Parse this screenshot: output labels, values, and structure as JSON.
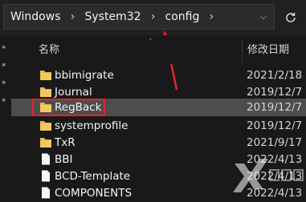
{
  "address": {
    "crumbs": [
      "Windows",
      "System32",
      "config"
    ],
    "dropdown_icon": "chevron-down-icon",
    "refresh_icon": "refresh-icon"
  },
  "columns": {
    "name": "名称",
    "date": "修改日期"
  },
  "files": [
    {
      "name": "bbimigrate",
      "date": "2021/2/18",
      "type": "folder"
    },
    {
      "name": "Journal",
      "date": "2019/12/7",
      "type": "folder"
    },
    {
      "name": "RegBack",
      "date": "2019/12/7",
      "type": "folder",
      "selected": true
    },
    {
      "name": "systemprofile",
      "date": "2019/12/7",
      "type": "folder"
    },
    {
      "name": "TxR",
      "date": "2021/9/17",
      "type": "folder"
    },
    {
      "name": "BBI",
      "date": "2022/4/13",
      "type": "file"
    },
    {
      "name": "BCD-Template",
      "date": "2022/4/13",
      "type": "file"
    },
    {
      "name": "COMPONENTS",
      "date": "2022/4/13",
      "type": "file"
    }
  ],
  "colors": {
    "background": "#191919",
    "selection": "#4d4d4d",
    "folder": "#e8b84a",
    "highlight": "#e8212b"
  }
}
